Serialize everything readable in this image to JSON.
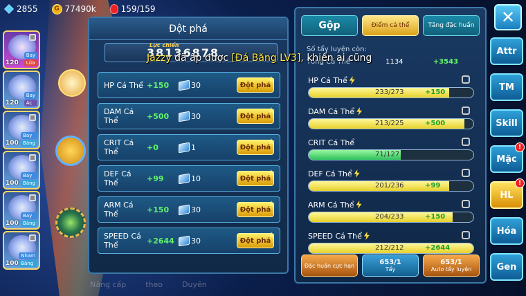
{
  "topbar": {
    "gems": "2855",
    "gold": "77490k",
    "energy": "159/159"
  },
  "team": [
    {
      "level": "120",
      "tags": [
        "Bay",
        "Lửa"
      ],
      "kind": "fire",
      "locked": true
    },
    {
      "level": "120",
      "tags": [
        "Bay",
        "Ác"
      ],
      "kind": "dark",
      "locked": false
    },
    {
      "level": "100",
      "tags": [
        "Bay",
        "Băng"
      ],
      "kind": "ice",
      "locked": true
    },
    {
      "level": "100",
      "tags": [
        "Bay",
        "Băng"
      ],
      "kind": "ice",
      "locked": true
    },
    {
      "level": "100",
      "tags": [
        "Bay",
        "Băng"
      ],
      "kind": "ice",
      "locked": true
    },
    {
      "level": "100",
      "tags": [
        "Nham",
        "Băng"
      ],
      "kind": "ice",
      "locked": true
    }
  ],
  "breakthrough": {
    "title": "Đột phá",
    "power_label": "Lực chiến",
    "power_value": "38136878",
    "button_label": "Đột phá",
    "rows": [
      {
        "name": "HP Cá Thể",
        "bonus": "+150",
        "cost": "30"
      },
      {
        "name": "DAM Cá Thể",
        "bonus": "+500",
        "cost": "30"
      },
      {
        "name": "CRIT Cá Thể",
        "bonus": "+0",
        "cost": "1"
      },
      {
        "name": "DEF Cá Thể",
        "bonus": "+99",
        "cost": "10"
      },
      {
        "name": "ARM Cá Thể",
        "bonus": "+150",
        "cost": "30"
      },
      {
        "name": "SPEED Cá Thể",
        "bonus": "+2644",
        "cost": "30"
      }
    ]
  },
  "stats_panel": {
    "tabs": [
      "Gộp",
      "Điểm cá thể",
      "Tăng đặc huấn"
    ],
    "remaining_label": "Số tẩy luyện còn:",
    "total_label": "Tổng Cá Thể",
    "total_value": "1134",
    "total_bonus": "+3543",
    "stats": [
      {
        "name": "HP Cá Thể",
        "value": "233/273",
        "bonus": "+150",
        "fill": 0.853,
        "bolt": true,
        "color": "yellow"
      },
      {
        "name": "DAM Cá Thể",
        "value": "213/225",
        "bonus": "+500",
        "fill": 0.947,
        "bolt": true,
        "color": "yellow"
      },
      {
        "name": "CRIT Cá Thể",
        "value": "71/127",
        "bonus": "",
        "fill": 0.559,
        "bolt": false,
        "color": "green"
      },
      {
        "name": "DEF Cá Thể",
        "value": "201/236",
        "bonus": "+99",
        "fill": 0.852,
        "bolt": true,
        "color": "yellow"
      },
      {
        "name": "ARM Cá Thể",
        "value": "204/233",
        "bonus": "+150",
        "fill": 0.876,
        "bolt": true,
        "color": "yellow"
      },
      {
        "name": "SPEED Cá Thể",
        "value": "212/212",
        "bonus": "+2644",
        "fill": 1.0,
        "bolt": true,
        "color": "yellow"
      }
    ],
    "buttons": [
      {
        "label": "Đặc huấn cực hạn",
        "count": ""
      },
      {
        "label": "Tẩy",
        "count": "653/1"
      },
      {
        "label": "Auto tẩy luyện",
        "count": "653/1"
      }
    ]
  },
  "side_menu": [
    {
      "label": "Attr",
      "badge": false
    },
    {
      "label": "TM",
      "badge": false
    },
    {
      "label": "Skill",
      "badge": false
    },
    {
      "label": "Mặc",
      "badge": true
    },
    {
      "label": "HL",
      "badge": true
    },
    {
      "label": "Hóa",
      "badge": false
    },
    {
      "label": "Gen",
      "badge": false
    }
  ],
  "chat": {
    "name": "Jazzy",
    "text": "đã ấp được",
    "item": "[Đá Băng LV3]",
    "tail": ", khiến ai cũng"
  },
  "bottom_nav": [
    "Nâng cấp",
    "theo",
    "Duyên"
  ]
}
